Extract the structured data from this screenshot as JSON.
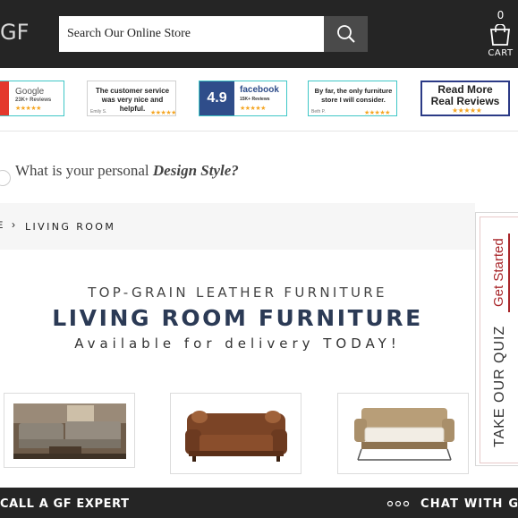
{
  "header": {
    "logo_text": "GF",
    "search": {
      "placeholder": "Search Our Online Store",
      "value": ""
    },
    "cart": {
      "count": "0",
      "label": "CART"
    }
  },
  "reviews": {
    "google": {
      "name": "Google",
      "count": "23K+ Reviews"
    },
    "quote1": {
      "text": "The customer service was very nice and helpful.",
      "author": "Emily S."
    },
    "facebook": {
      "rating": "4.9",
      "name": "facebook",
      "count": "15K+ Reviews"
    },
    "quote2": {
      "text": "By far, the only furniture store I will consider.",
      "author": "Beth P."
    },
    "more": {
      "line1": "Read More",
      "line2": "Real Reviews"
    }
  },
  "design_style": {
    "prefix": "What is your personal ",
    "emphasis": "Design Style?"
  },
  "breadcrumb": {
    "previous": "E",
    "separator": "›",
    "current": "LIVING ROOM"
  },
  "quiz_tab": {
    "get_started": "Get Started",
    "title": "TAKE OUR QUIZ"
  },
  "headline": {
    "subtitle": "TOP-GRAIN LEATHER FURNITURE",
    "title": "LIVING ROOM FURNITURE",
    "availability": "Available for delivery TODAY!"
  },
  "products": [
    {
      "name": "Leather sectional set"
    },
    {
      "name": "Brown leather sofa with pillows"
    },
    {
      "name": "Sleeper sofa bed"
    }
  ],
  "footer": {
    "call": "CALL A GF EXPERT",
    "chat": "CHAT WITH GF"
  },
  "colors": {
    "header_bg": "#252525",
    "accent_red": "#a8262a",
    "navy": "#2b3a55",
    "star": "#f5a623"
  }
}
